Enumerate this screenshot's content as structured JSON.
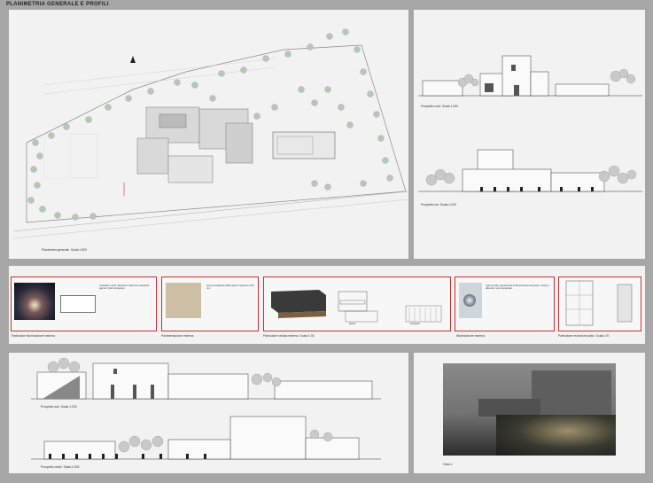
{
  "title": "PLANIMETRIA GENERALE E PROFILI",
  "site_plan": {
    "caption": "Planimetria generale",
    "scale": "Scala 1:500"
  },
  "elevations_top": [
    {
      "caption": "Prospetto nord",
      "scale": "Scala 1:200"
    },
    {
      "caption": "Prospetto est",
      "scale": "Scala 1:200"
    }
  ],
  "details": [
    {
      "caption": "Particolare illuminazione esterna",
      "note": "Incassato a terra. Struttura in alluminio resistente agli urti. Vetro temperato."
    },
    {
      "caption": "Pavimentazione esterna",
      "note": "Gres porcellanato effetto pietra. Spessore 10,5 mm"
    },
    {
      "caption": "Particolare seduta esterna",
      "scale": "Scala 1:30",
      "sub_labels": [
        "pianta",
        "prospetto"
      ]
    },
    {
      "caption": "Illuminazione esterna",
      "note": "Light up light. Apparecchio di illuminazione da parete. Corpo in alluminio, vetro temperato."
    },
    {
      "caption": "Particolare recinzione patio",
      "scale": "Scala 1:5"
    }
  ],
  "elevations_bottom": [
    {
      "caption": "Prospetto sud",
      "scale": "Scala 1:200"
    },
    {
      "caption": "Prospetto ovest",
      "scale": "Scala 1:200"
    }
  ],
  "render": {
    "caption": "Vista 1"
  },
  "colors": {
    "accent_red": "#c8302f",
    "panel": "#f2f2f2",
    "background": "#a6a6a6"
  }
}
